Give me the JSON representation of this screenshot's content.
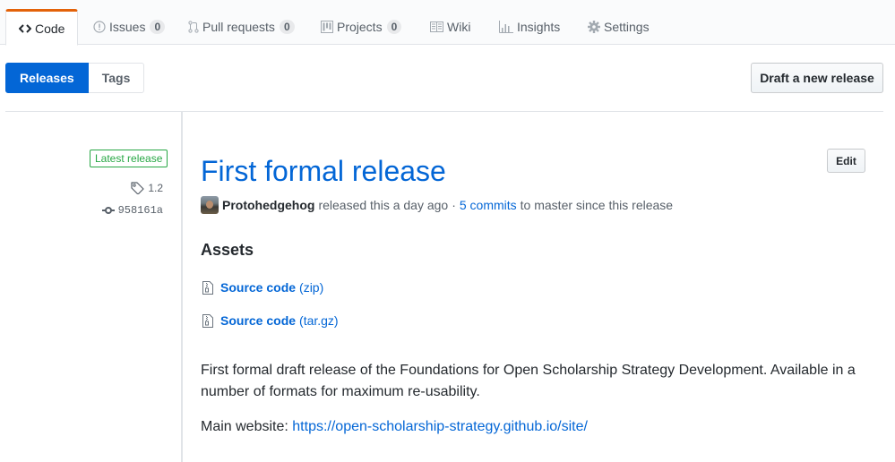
{
  "reponav": {
    "tabs": [
      {
        "label": "Code",
        "icon": "code-icon",
        "selected": true
      },
      {
        "label": "Issues",
        "icon": "issue-icon",
        "count": "0"
      },
      {
        "label": "Pull requests",
        "icon": "pull-request-icon",
        "count": "0"
      },
      {
        "label": "Projects",
        "icon": "project-icon",
        "count": "0"
      },
      {
        "label": "Wiki",
        "icon": "book-icon"
      },
      {
        "label": "Insights",
        "icon": "graph-icon"
      },
      {
        "label": "Settings",
        "icon": "gear-icon"
      }
    ]
  },
  "subnav": {
    "releases_label": "Releases",
    "tags_label": "Tags"
  },
  "toolbar": {
    "draft_label": "Draft a new release"
  },
  "release": {
    "badge": "Latest release",
    "tag": "1.2",
    "commit": "958161a",
    "title": "First formal release",
    "edit_label": "Edit",
    "author": "Protohedgehog",
    "released_text": "released this a day ago",
    "separator": "·",
    "commits_link": "5 commits",
    "commits_suffix": "to master since this release",
    "assets_heading": "Assets",
    "assets": [
      {
        "name": "Source code",
        "ext": "(zip)"
      },
      {
        "name": "Source code",
        "ext": "(tar.gz)"
      }
    ],
    "description": "First formal draft release of the Foundations for Open Scholarship Strategy Development. Available in a number of formats for maximum re-usability.",
    "website_label": "Main website:",
    "website_url": "https://open-scholarship-strategy.github.io/site/"
  },
  "colors": {
    "accent": "#0366d6",
    "tab_highlight": "#e36209",
    "latest_badge": "#28a745"
  }
}
